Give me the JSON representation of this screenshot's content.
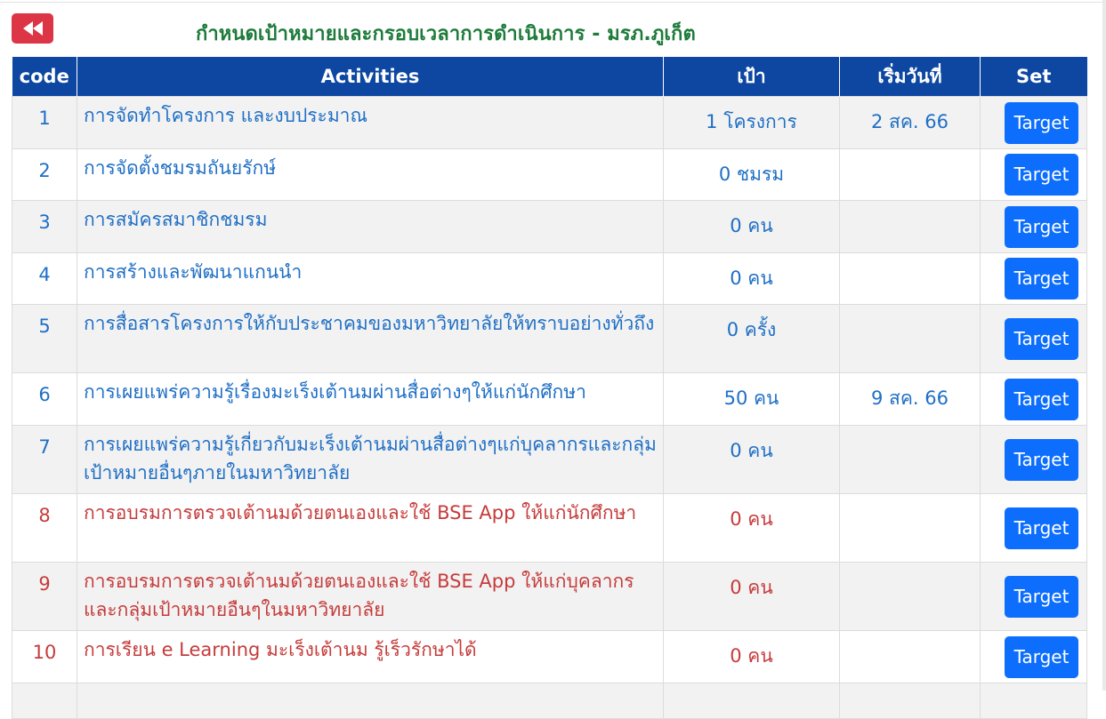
{
  "page": {
    "title": "กำหนดเป้าหมายและกรอบเวลาการดำเนินการ - มรภ.ภูเก็ต",
    "back_icon": "double-chevron-left-icon"
  },
  "colors": {
    "header_bg": "#0d47a1",
    "title_green": "#1e7b3a",
    "back_red": "#dc3545",
    "target_blue": "#0d6efd",
    "row_text_blue": "#1f6fc5",
    "row_text_red": "#c63b3b"
  },
  "table": {
    "headers": [
      "code",
      "Activities",
      "เป้า",
      "เริ่มวันที่",
      "Set"
    ],
    "rows": [
      {
        "code": "1",
        "activity": "การจัดทำโครงการ และงบประมาณ",
        "goal": "1 โครงการ",
        "start": "2 สค. 66",
        "button": "Target"
      },
      {
        "code": "2",
        "activity": "การจัดตั้งชมรมถันยรักษ์",
        "goal": "0 ชมรม",
        "start": "",
        "button": "Target"
      },
      {
        "code": "3",
        "activity": "การสมัครสมาชิกชมรม",
        "goal": "0 คน",
        "start": "",
        "button": "Target"
      },
      {
        "code": "4",
        "activity": "การสร้างและพัฒนาแกนนำ",
        "goal": "0 คน",
        "start": "",
        "button": "Target"
      },
      {
        "code": "5",
        "activity": "การสื่อสารโครงการให้กับประชาคมของมหาวิทยาลัยให้ทราบอย่างทั่วถึง",
        "goal": "0 ครั้ง",
        "start": "",
        "button": "Target"
      },
      {
        "code": "6",
        "activity": "การเผยแพร่ความรู้เรื่องมะเร็งเต้านมผ่านสื่อต่างๆให้แก่นักศึกษา",
        "goal": "50 คน",
        "start": "9 สค. 66",
        "button": "Target"
      },
      {
        "code": "7",
        "activity": "การเผยแพร่ความรู้เกี่ยวกับมะเร็งเต้านมผ่านสื่อต่างๆแก่บุคลากรและกลุ่มเป้าหมายอื่นๆภายในมหาวิทยาลัย",
        "goal": "0 คน",
        "start": "",
        "button": "Target"
      },
      {
        "code": "8",
        "activity": "การอบรมการตรวจเต้านมด้วยตนเองและใช้ BSE App ให้แก่นักศึกษา",
        "goal": "0 คน",
        "start": "",
        "button": "Target"
      },
      {
        "code": "9",
        "activity": "การอบรมการตรวจเต้านมด้วยตนเองและใช้ BSE App ให้แก่บุคลากรและกลุ่มเป้าหมายอืนๆในมหาวิทยาลัย",
        "goal": "0 คน",
        "start": "",
        "button": "Target"
      },
      {
        "code": "10",
        "activity": "การเรียน e Learning มะเร็งเต้านม รู้เร็วรักษาได้",
        "goal": "0 คน",
        "start": "",
        "button": "Target"
      }
    ]
  }
}
